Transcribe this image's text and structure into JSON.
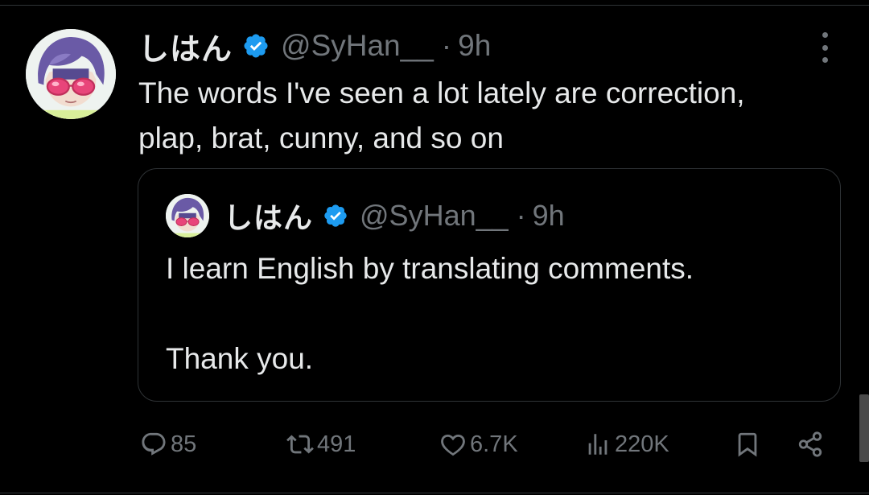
{
  "tweet": {
    "author_name": "しはん",
    "handle": "@SyHan__",
    "separator": "·",
    "time": "9h",
    "text": "The words I've seen a lot lately are correction,\nplap, brat, cunny, and so on"
  },
  "quoted_tweet": {
    "author_name": "しはん",
    "handle": "@SyHan__",
    "separator": "·",
    "time": "9h",
    "text": "I learn English by translating comments.\n\nThank you."
  },
  "metrics": {
    "replies": "85",
    "retweets": "491",
    "likes": "6.7K",
    "views": "220K"
  },
  "icons": {
    "verified": "verified-badge-icon",
    "more": "more-vertical-icon",
    "reply": "reply-icon",
    "retweet": "retweet-icon",
    "like": "heart-icon",
    "views": "views-icon",
    "bookmark": "bookmark-icon",
    "share": "share-icon"
  },
  "colors": {
    "background": "#000000",
    "text_primary": "#e7e9ea",
    "text_secondary": "#71767b",
    "verified_blue": "#1d9bf0",
    "border": "#2f3336",
    "avatar_hair": "#6a5aa6",
    "avatar_glasses": "#e8457a"
  }
}
